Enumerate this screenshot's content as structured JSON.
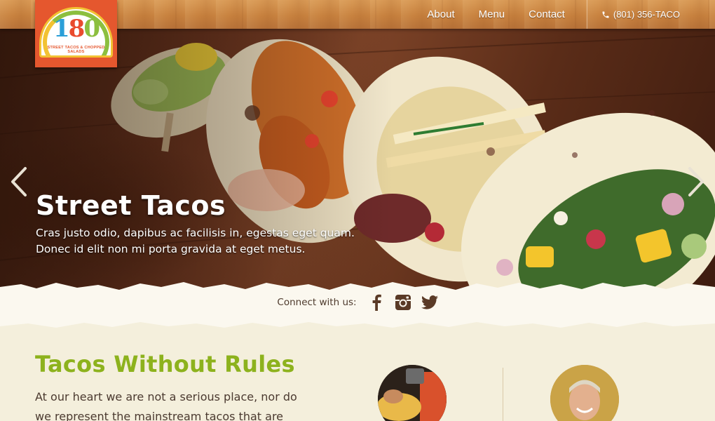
{
  "brand": {
    "logo_number": [
      "1",
      "8",
      "0"
    ],
    "logo_tagline": "STREET TACOS & CHOPPED SALADS"
  },
  "nav": {
    "items": [
      {
        "label": "About"
      },
      {
        "label": "Menu"
      },
      {
        "label": "Contact"
      }
    ],
    "phone": "(801) 356-TACO",
    "phone_icon": "phone-icon"
  },
  "hero": {
    "title": "Street Tacos",
    "text": "Cras justo odio, dapibus ac facilisis in, egestas eget quam. Donec id elit non mi porta gravida at eget metus.",
    "prev_icon": "chevron-left-icon",
    "next_icon": "chevron-right-icon"
  },
  "connect": {
    "label": "Connect with us:",
    "icons": [
      "facebook-icon",
      "instagram-icon",
      "twitter-icon"
    ]
  },
  "section": {
    "title": "Tacos Without Rules",
    "text": "At our heart we are not a serious place, nor do we represent the mainstream tacos that are"
  },
  "colors": {
    "accent_green": "#8db21d",
    "logo_orange": "#e5572e",
    "paper": "#f4efdc",
    "body_text": "#4b3a30"
  }
}
